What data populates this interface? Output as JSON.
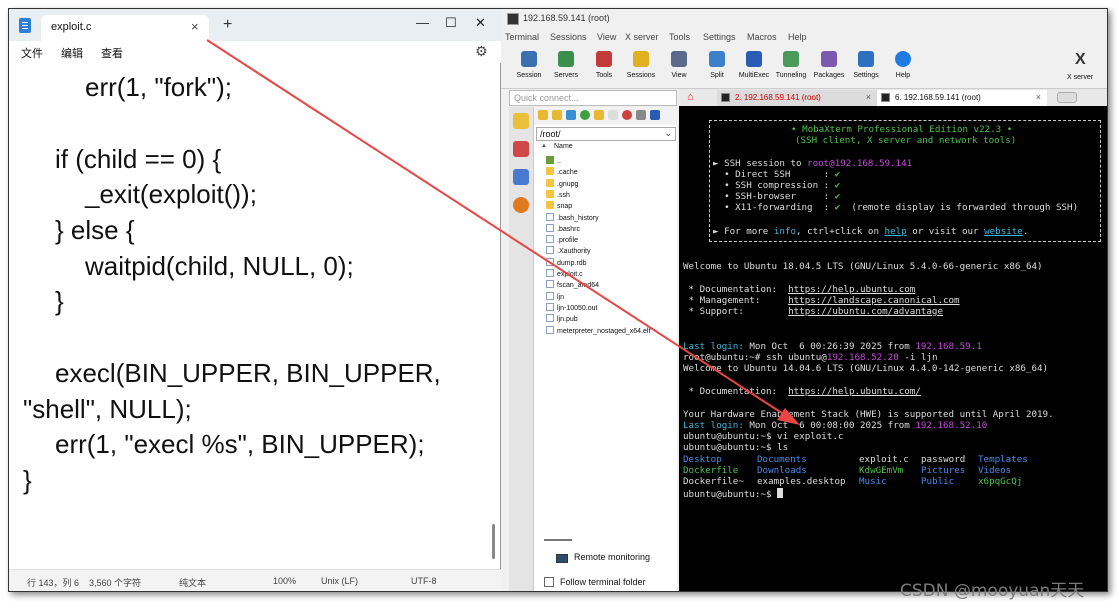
{
  "notepad": {
    "tab_label": "exploit.c",
    "tab_close": "×",
    "new_tab": "+",
    "win_minimize": "—",
    "win_maximize": "☐",
    "win_close": "✕",
    "menu": [
      "文件",
      "编辑",
      "查看"
    ],
    "settings_icon": "⚙",
    "code_lines": [
      "err(1, \"fork\");",
      "if (child == 0) {",
      "_exit(exploit());",
      "} else {",
      "waitpid(child, NULL, 0);",
      "}",
      "execl(BIN_UPPER, BIN_UPPER,",
      "\"shell\", NULL);",
      "err(1, \"execl %s\", BIN_UPPER);",
      "}"
    ],
    "status": {
      "position": "行 143，列 6",
      "chars": "3,560 个字符",
      "format": "纯文本",
      "zoom": "100%",
      "line_ending": "Unix (LF)",
      "encoding": "UTF-8"
    }
  },
  "mobaxterm": {
    "title": "192.168.59.141 (root)",
    "menu": [
      "Terminal",
      "Sessions",
      "View",
      "X server",
      "Tools",
      "Settings",
      "Macros",
      "Help"
    ],
    "toolbar": [
      "Session",
      "Servers",
      "Tools",
      "Sessions",
      "View",
      "Split",
      "MultiExec",
      "Tunneling",
      "Packages",
      "Settings",
      "Help"
    ],
    "xserver_label": "X server",
    "quick_connect_placeholder": "Quick connect...",
    "path": "/root/",
    "name_header": "Name",
    "files": [
      {
        "name": "..",
        "kind": "up"
      },
      {
        "name": ".cache",
        "kind": "folder"
      },
      {
        "name": ".gnupg",
        "kind": "folder"
      },
      {
        "name": ".ssh",
        "kind": "folder"
      },
      {
        "name": "snap",
        "kind": "folder"
      },
      {
        "name": ".bash_history",
        "kind": "file"
      },
      {
        "name": ".bashrc",
        "kind": "file"
      },
      {
        "name": ".profile",
        "kind": "file"
      },
      {
        "name": ".Xauthority",
        "kind": "file"
      },
      {
        "name": "dump.rdb",
        "kind": "file"
      },
      {
        "name": "exploit.c",
        "kind": "file"
      },
      {
        "name": "fscan_amd64",
        "kind": "file"
      },
      {
        "name": "ljn",
        "kind": "file"
      },
      {
        "name": "ljn-10050.out",
        "kind": "file"
      },
      {
        "name": "ljn.pub",
        "kind": "file"
      },
      {
        "name": "meterpreter_nostaged_x64.elf",
        "kind": "file"
      }
    ],
    "remote_monitoring": "Remote monitoring",
    "follow_folder": "Follow terminal folder",
    "tabs": [
      {
        "label": "2. 192.168.59.141 (root)"
      },
      {
        "label": "6. 192.168.59.141 (root)"
      }
    ],
    "tab_close": "×",
    "terminal": {
      "banner_title": "• MobaXterm Professional Edition v22.3 •",
      "banner_sub": "(SSH client, X server and network tools)",
      "ssh_session_prefix": "► SSH session to ",
      "ssh_target": "root@192.168.59.141",
      "features": [
        {
          "name": "  • Direct SSH      :",
          "value": "✔",
          "note": ""
        },
        {
          "name": "  • SSH compression :",
          "value": "✔",
          "note": ""
        },
        {
          "name": "  • SSH-browser     :",
          "value": "✔",
          "note": ""
        },
        {
          "name": "  • X11-forwarding  :",
          "value": "✔",
          "note": "  (remote display is forwarded through SSH)"
        }
      ],
      "more_prefix": "► For more ",
      "more_info": "info",
      "more_mid": ", ctrl+click on ",
      "more_help": "help",
      "more_mid2": " or visit our ",
      "more_site": "website",
      "more_end": ".",
      "welcome1": "Welcome to Ubuntu 18.04.5 LTS (GNU/Linux 5.4.0-66-generic x86_64)",
      "doc_label": " * Documentation:  ",
      "doc_url": "https://help.ubuntu.com",
      "mgmt_label": " * Management:     ",
      "mgmt_url": "https://landscape.canonical.com",
      "sup_label": " * Support:        ",
      "sup_url": "https://ubuntu.com/advantage",
      "last_login1_label": "Last login:",
      "last_login1_text": " Mon Oct  6 00:26:39 2025 from ",
      "last_login1_ip": "192.168.59.1",
      "ssh_cmd_prompt": "root@ubuntu:~# ssh ubuntu@",
      "ssh_cmd_ip": "192.168.52.20",
      "ssh_cmd_rest": " -i ljn",
      "welcome2": "Welcome to Ubuntu 14.04.6 LTS (GNU/Linux 4.4.0-142-generic x86_64)",
      "doc2_label": " * Documentation:  ",
      "doc2_url": "https://help.ubuntu.com/",
      "hwe": "Your Hardware Enablement Stack (HWE) is supported until April 2019.",
      "last_login2_label": "Last login:",
      "last_login2_text": " Mon Oct  6 00:08:00 2025 from ",
      "last_login2_ip": "192.168.52.10",
      "cmd_vi": "ubuntu@ubuntu:~$ vi exploit.c",
      "cmd_ls": "ubuntu@ubuntu:~$ ls",
      "ls_rows": [
        [
          "Desktop",
          "Documents",
          "exploit.c",
          "password",
          "Templates"
        ],
        [
          "Dockerfile",
          "Downloads",
          "KdwGEmVm",
          "Pictures",
          "Videos"
        ],
        [
          "Dockerfile~",
          "examples.desktop",
          "Music",
          "Public",
          "x6pqGcQj"
        ]
      ],
      "final_prompt": "ubuntu@ubuntu:~$ "
    }
  },
  "watermark": "CSDN @mooyuan天天",
  "colors": {
    "arrow": "#e84545",
    "terminal_bg": "#000000",
    "green": "#4ec24e",
    "purple": "#c54ad8",
    "cyan": "#3fb6d8"
  }
}
